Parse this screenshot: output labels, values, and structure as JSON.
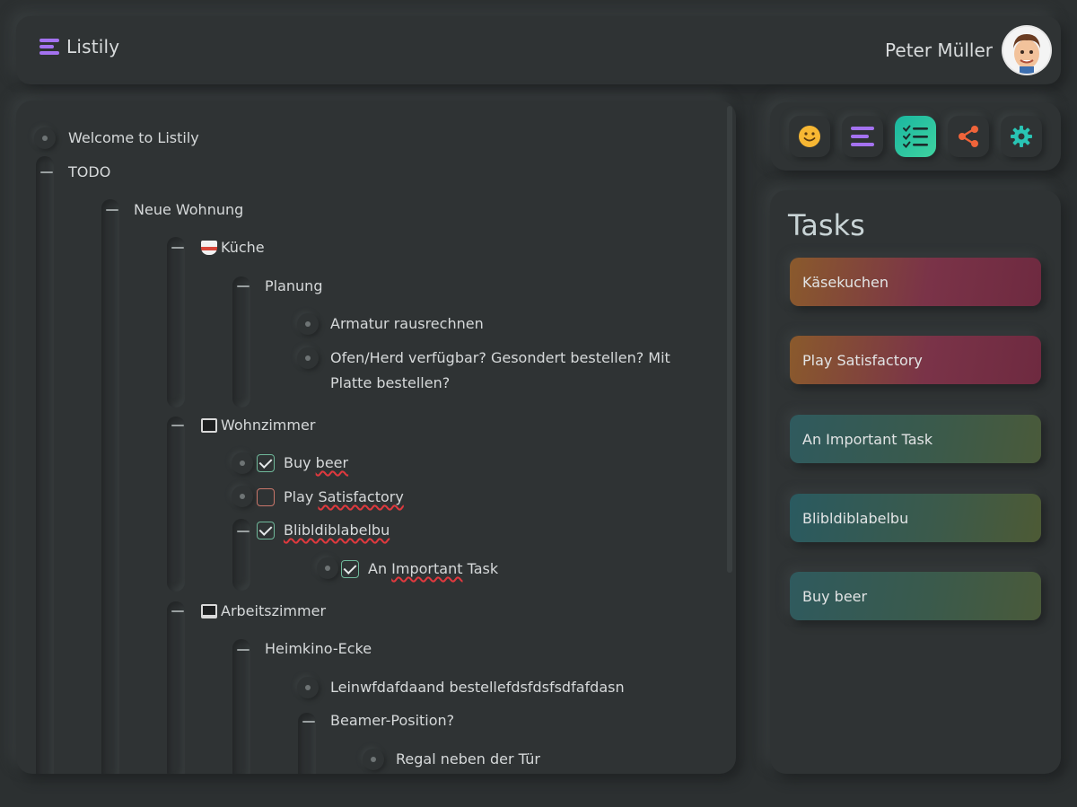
{
  "header": {
    "app_name": "Listily",
    "user_name": "Peter Müller"
  },
  "tree": {
    "welcome": "Welcome to Listily",
    "todo": "TODO",
    "neue_wohnung": "Neue Wohnung",
    "kueche": "Küche",
    "planung": "Planung",
    "armatur": "Armatur rausrechnen",
    "ofen": "Ofen/Herd verfügbar? Gesondert bestellen? Mit Platte bestellen?",
    "wohnzimmer": "Wohnzimmer",
    "buy_prefix": "Buy ",
    "buy_word": "beer",
    "play_prefix": "Play ",
    "play_word": "Satisfactory",
    "blib": "Blibldiblabelbu",
    "an_prefix": "An ",
    "an_word": "Important",
    "an_suffix": " Task",
    "arbeitszimmer": "Arbeitszimmer",
    "heimkino": "Heimkino-Ecke",
    "leinw": "Leinwfdafdaand bestellefdsfdsfsdfafdasn",
    "beamer": "Beamer-Position?",
    "regal": "Regal neben der Tür"
  },
  "toolbar": {
    "items": [
      "smiley-icon",
      "list-icon",
      "checklist-icon",
      "share-icon",
      "settings-icon"
    ],
    "active": "checklist-icon"
  },
  "tasks": {
    "title": "Tasks",
    "items": [
      "Käsekuchen",
      "Play Satisfactory",
      "An Important Task",
      "Blibldiblabelbu",
      "Buy beer"
    ]
  },
  "colors": {
    "accent_purple": "#a472f0",
    "accent_green": "#1ab6a0",
    "share_orange": "#f0643a",
    "settings_teal": "#29c4b4",
    "smiley_yellow": "#f7b733"
  }
}
